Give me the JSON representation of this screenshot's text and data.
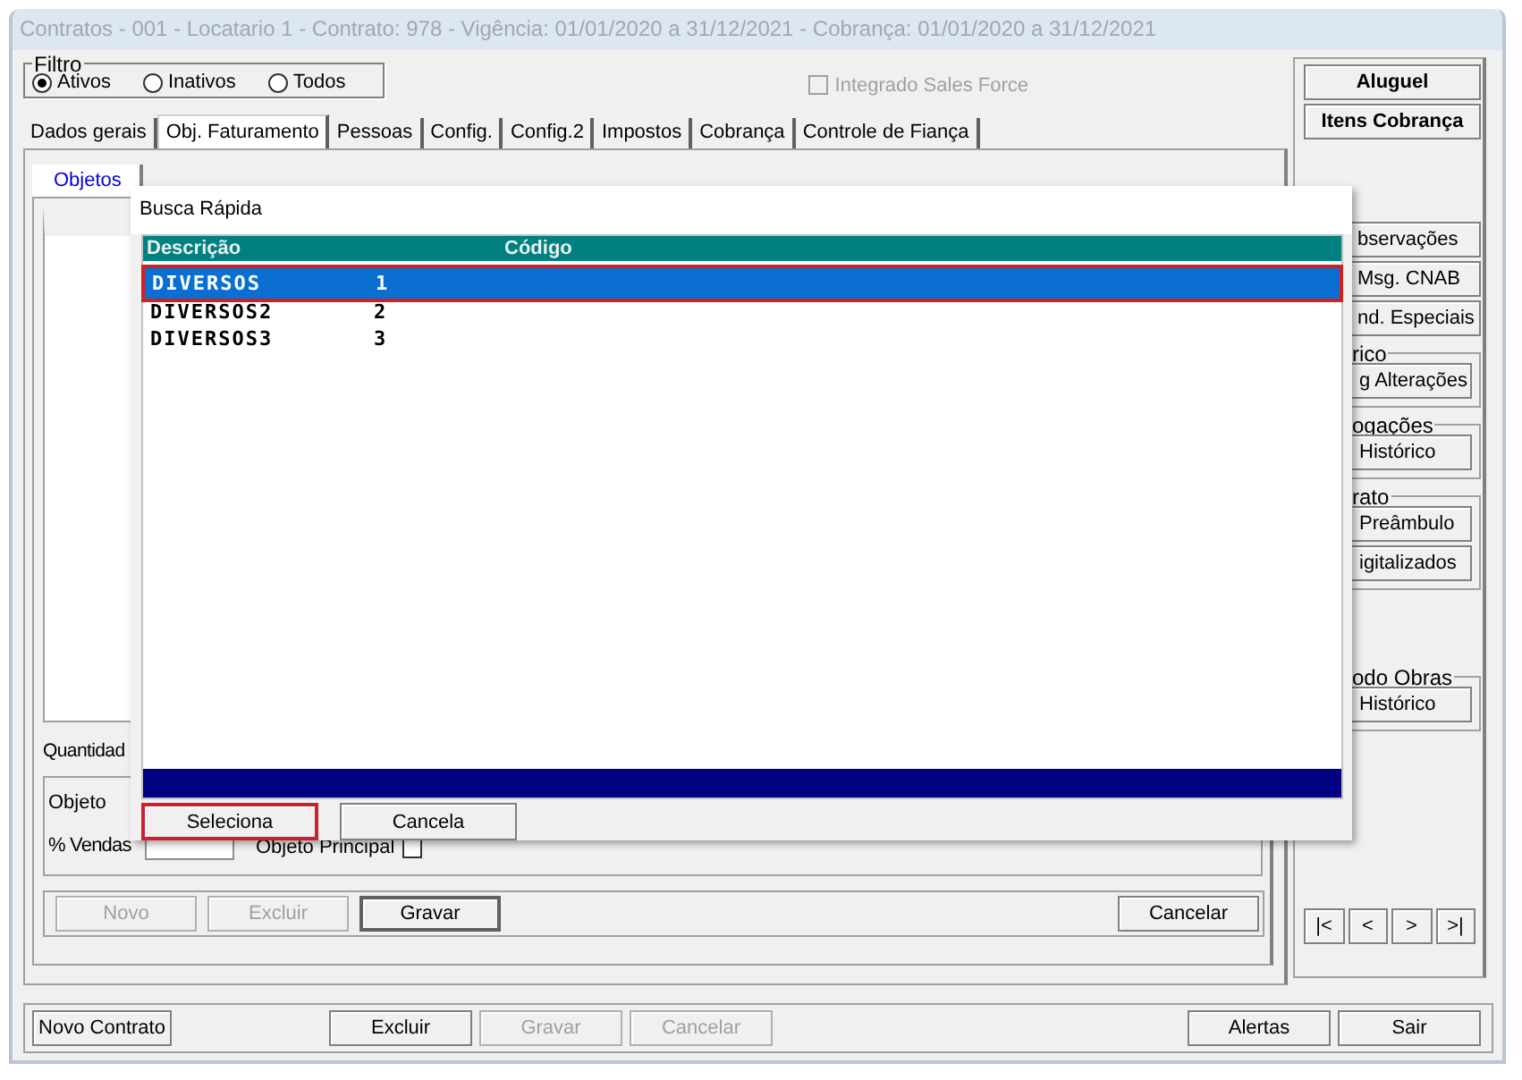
{
  "window": {
    "title": "Contratos - 001 - Locatario 1 - Contrato: 978 - Vigência: 01/01/2020 a 31/12/2021 - Cobrança: 01/01/2020 a 31/12/2021"
  },
  "filter": {
    "label": "Filtro",
    "options": [
      {
        "label": "Ativos",
        "selected": true
      },
      {
        "label": "Inativos",
        "selected": false
      },
      {
        "label": "Todos",
        "selected": false
      }
    ]
  },
  "integrado": {
    "label": "Integrado Sales Force",
    "checked": false,
    "disabled": true
  },
  "tabs": [
    {
      "label": "Dados gerais",
      "selected": false
    },
    {
      "label": "Obj. Faturamento",
      "selected": true
    },
    {
      "label": "Pessoas",
      "selected": false
    },
    {
      "label": "Config.",
      "selected": false
    },
    {
      "label": "Config.2",
      "selected": false
    },
    {
      "label": "Impostos",
      "selected": false
    },
    {
      "label": "Cobrança",
      "selected": false
    },
    {
      "label": "Controle de Fiança",
      "selected": false
    }
  ],
  "subtabs": [
    {
      "label": "Objetos",
      "selected": true
    }
  ],
  "objeto_panel": {
    "quantity_label": "Quantidad",
    "objeto_label": "Objeto",
    "vendas_label": "% Vendas",
    "principal": {
      "label": "Objeto Principal",
      "checked": false
    }
  },
  "object_buttons": {
    "left": [
      {
        "label": "Novo",
        "disabled": true
      },
      {
        "label": "Excluir",
        "disabled": true
      },
      {
        "label": "Gravar",
        "disabled": false
      }
    ],
    "right": [
      {
        "label": "Cancelar",
        "disabled": false
      }
    ]
  },
  "side_panel": {
    "main_buttons": [
      "Aluguel",
      "Itens Cobrança"
    ],
    "buttons": [
      "bservações",
      "Msg. CNAB",
      "nd. Especiais"
    ],
    "groups": [
      {
        "label": "rico",
        "buttons": [
          "g Alterações"
        ]
      },
      {
        "label": "ogações",
        "buttons": [
          "Histórico"
        ]
      },
      {
        "label": "rato",
        "buttons": [
          "Preâmbulo",
          "igitalizados"
        ]
      },
      {
        "label": "odo Obras",
        "buttons": [
          "Histórico"
        ]
      }
    ],
    "nav_buttons": [
      "|<",
      "<",
      ">",
      ">|"
    ]
  },
  "bottom_bar": {
    "left": [
      {
        "label": "Novo Contrato",
        "disabled": false
      }
    ],
    "center": [
      {
        "label": "Excluir",
        "disabled": false
      },
      {
        "label": "Gravar",
        "disabled": true
      },
      {
        "label": "Cancelar",
        "disabled": true
      }
    ],
    "right": [
      {
        "label": "Alertas",
        "disabled": false
      },
      {
        "label": "Sair",
        "disabled": false
      }
    ]
  },
  "dialog": {
    "title": "Busca Rápida",
    "columns": [
      "Descrição",
      "Código"
    ],
    "rows": [
      {
        "descricao": "DIVERSOS",
        "codigo": "1",
        "selected": true
      },
      {
        "descricao": "DIVERSOS2",
        "codigo": "2",
        "selected": false
      },
      {
        "descricao": "DIVERSOS3",
        "codigo": "3",
        "selected": false
      }
    ],
    "buttons": [
      {
        "label": "Seleciona",
        "focused": true
      },
      {
        "label": "Cancela",
        "focused": false
      }
    ]
  }
}
